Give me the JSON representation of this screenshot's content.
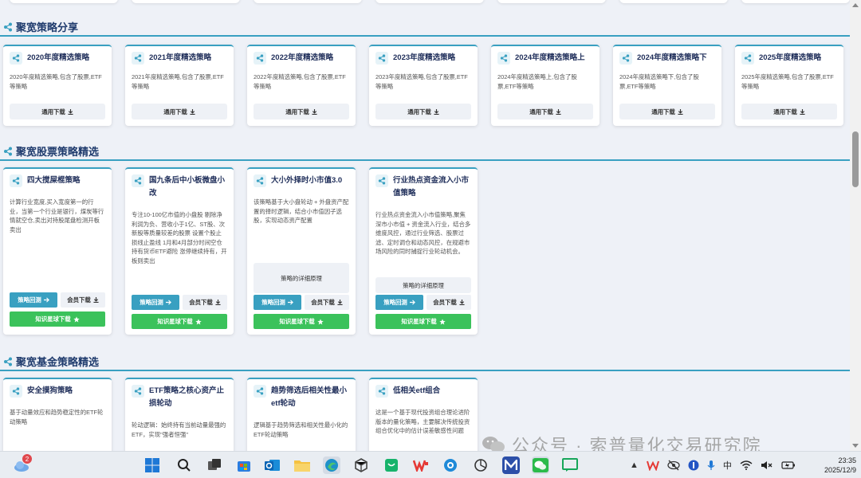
{
  "sections": {
    "s1": {
      "title": "聚宽策略分享"
    },
    "s2": {
      "title": "聚宽股票策略精选"
    },
    "s3": {
      "title": "聚宽基金策略精选"
    }
  },
  "labels": {
    "general_download": "通用下载",
    "backtest": "策略回测",
    "member_download": "会员下载",
    "planet_download": "知识星球下载",
    "detail": "策略的详细原理"
  },
  "share_cards": [
    {
      "title": "2020年度精选策略",
      "desc": "2020年度精选策略,包含了股票,ETF等策略"
    },
    {
      "title": "2021年度精选策略",
      "desc": "2021年度精选策略,包含了股票,ETF等策略"
    },
    {
      "title": "2022年度精选策略",
      "desc": "2022年度精选策略,包含了股票,ETF等策略"
    },
    {
      "title": "2023年度精选策略",
      "desc": "2023年度精选策略,包含了股票,ETF等策略"
    },
    {
      "title": "2024年度精选策略上",
      "desc": "2024年度精选策略上,包含了股票,ETF等策略"
    },
    {
      "title": "2024年度精选策略下",
      "desc": "2024年度精选策略下,包含了股票,ETF等策略"
    },
    {
      "title": "2025年度精选策略",
      "desc": "2025年度精选策略,包含了股票,ETF等策略"
    }
  ],
  "stock_cards": [
    {
      "title": "四大搅屎棍策略",
      "desc": "计算行业宽度,买入宽度第一的行业，当第一个行业是银行，煤炭等行情就空仓,卖出对持股尾盘检测开板卖出"
    },
    {
      "title": "国九条后中小板微盘小改",
      "desc": "专注10-100亿市值的小盘股 剔除净利润为负、营收小于1亿、ST股、次新股等质量较差的股票 设置个股止损线止盈线 1月和4月部分时间空仓持有货币ETF避险 涨停继续持有，开板则卖出"
    },
    {
      "title": "大小外择时小市值3.0",
      "desc": "该策略基于大小盘轮动 + 外盘资产配置的择时逻辑，结合小市值因子选股，实现动态资产配置"
    },
    {
      "title": "行业热点资金流入小市值策略",
      "desc": "行业热点资金流入小市值策略,聚焦深市小市值 + 资金流入行业，结合多维度风控，通过行业筛选、股票过滤、定时调仓和动态风控，在规避市场风险的同时捕捉行业轮动机会。"
    }
  ],
  "fund_cards": [
    {
      "title": "安全摸狗策略",
      "desc": "基于动量效应和趋势稳定性的ETF轮动策略"
    },
    {
      "title": "ETF策略之核心资产止损轮动",
      "desc": "轮动逻辑：始终持有当前动量最强的ETF，实现\"强者恒强\""
    },
    {
      "title": "趋势筛选后相关性最小etf轮动",
      "desc": "逻辑基于趋势筛选和相关性最小化的ETF轮动策略"
    },
    {
      "title": "低相关etf组合",
      "desc": "这是一个基于现代投资组合理论进阶版本的量化策略，主要解决传统投资组合优化中的估计误差敏感性问题"
    }
  ],
  "watermark": {
    "text": "公众号 · 索普量化交易研究院"
  },
  "taskbar": {
    "weather_badge": "2",
    "ime": "中",
    "time": "23:35",
    "date": "2025/12/9"
  },
  "colors": {
    "accent": "#39a0c1",
    "green": "#3bc25b",
    "title": "#1f3b6d"
  }
}
